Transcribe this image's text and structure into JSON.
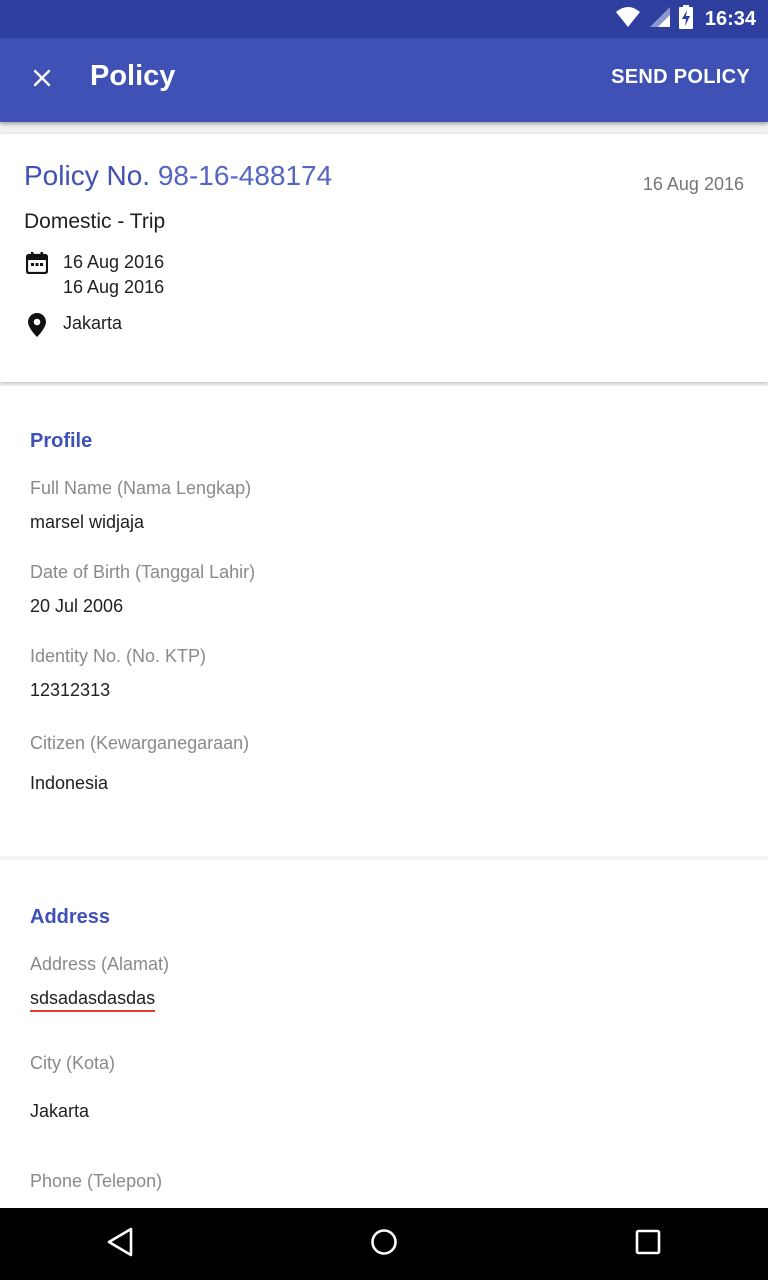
{
  "status_bar": {
    "time": "16:34",
    "icons": [
      "wifi-icon",
      "signal-icon",
      "battery-charging-icon"
    ]
  },
  "app_bar": {
    "title": "Policy",
    "close_icon": "close-icon",
    "send_label": "SEND POLICY",
    "color": "#3f51b5"
  },
  "policy_card": {
    "label": "Policy No.",
    "number": "98-16-488174",
    "issue_date": "16 Aug 2016",
    "trip_type": "Domestic - Trip",
    "start_date": "16 Aug 2016",
    "end_date": "16 Aug 2016",
    "location": "Jakarta"
  },
  "profile": {
    "title": "Profile",
    "full_name_label": "Full Name (Nama Lengkap)",
    "full_name": "marsel widjaja",
    "dob_label": "Date of Birth (Tanggal Lahir)",
    "dob": "20 Jul 2006",
    "identity_label": "Identity No. (No. KTP)",
    "identity": "12312313",
    "citizen_label": "Citizen (Kewarganegaraan)",
    "citizen": "Indonesia"
  },
  "address": {
    "title": "Address",
    "address_label": "Address (Alamat)",
    "address": "sdsadasdasdas",
    "city_label": "City (Kota)",
    "city": "Jakarta",
    "phone_label": "Phone (Telepon)"
  },
  "nav_bar": {
    "icons": [
      "back-icon",
      "home-icon",
      "recents-icon"
    ]
  }
}
